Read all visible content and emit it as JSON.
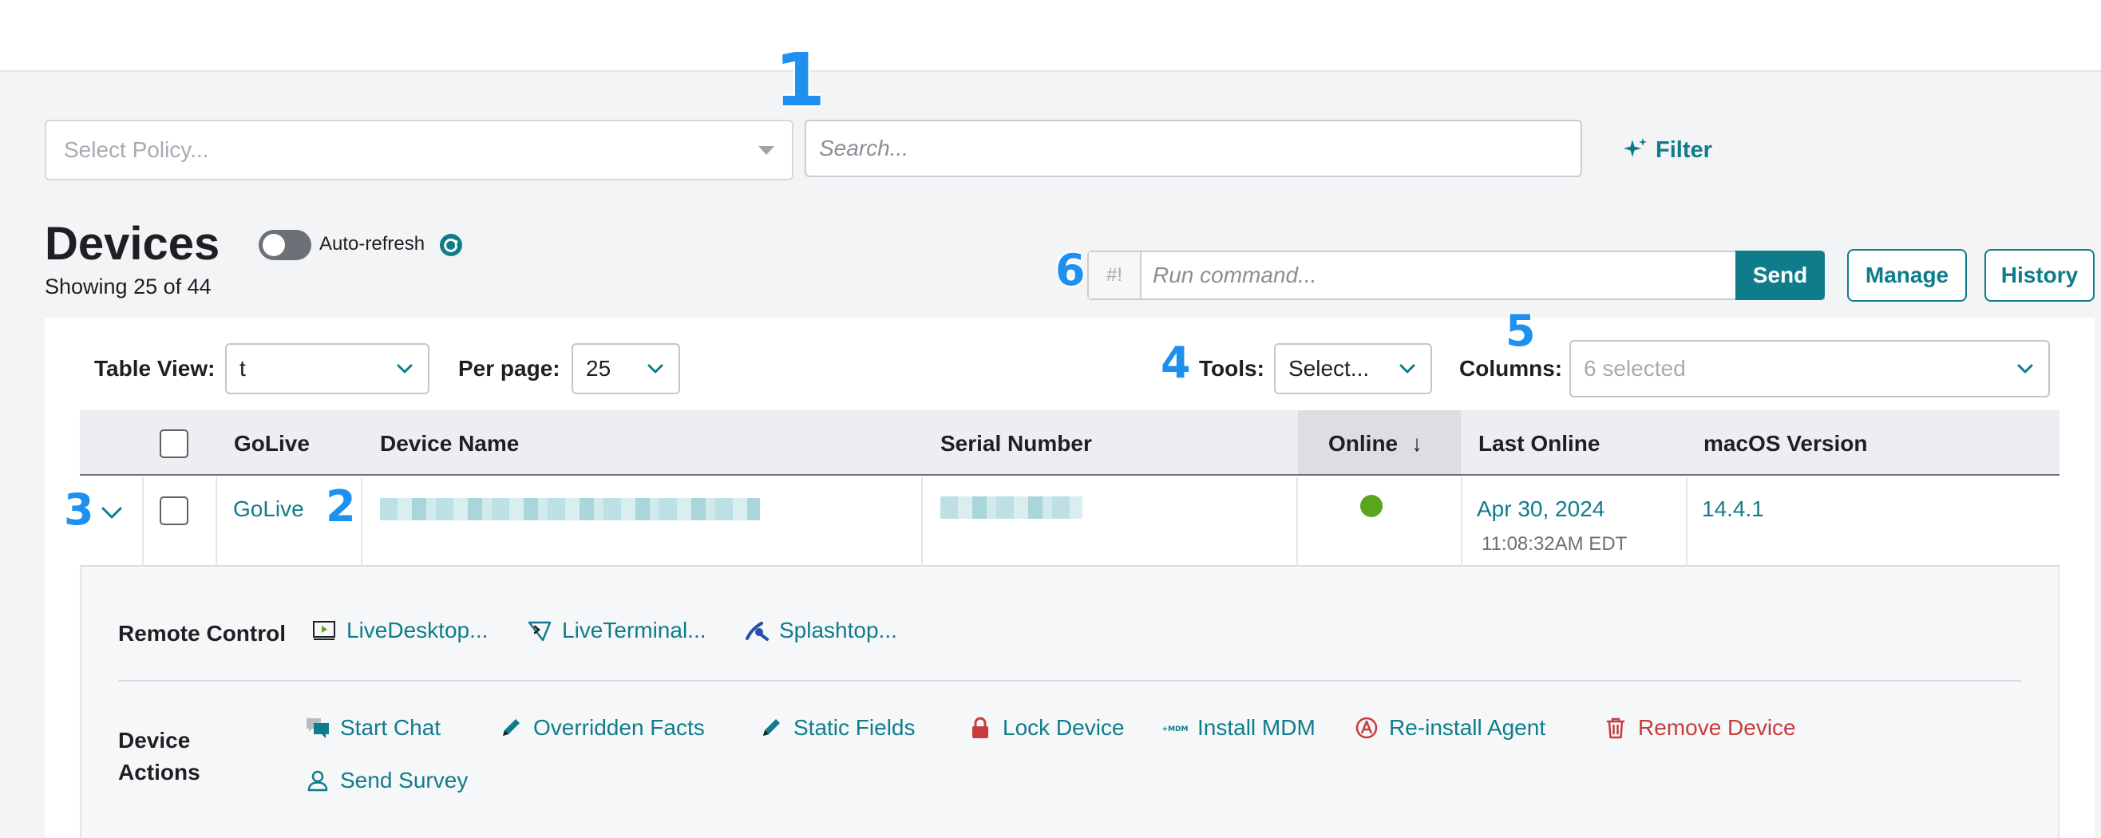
{
  "callouts": [
    "1",
    "2",
    "3",
    "4",
    "5",
    "6"
  ],
  "filters": {
    "policy_placeholder": "Select Policy...",
    "search_placeholder": "Search...",
    "filter_label": "Filter"
  },
  "header": {
    "title": "Devices",
    "showing": "Showing 25 of 44",
    "auto_refresh_label": "Auto-refresh",
    "auto_refresh_on": false
  },
  "command": {
    "prefix": "#!",
    "placeholder": "Run command...",
    "send_label": "Send",
    "manage_label": "Manage",
    "history_label": "History"
  },
  "table_controls": {
    "table_view_label": "Table View:",
    "table_view_value": "t",
    "per_page_label": "Per page:",
    "per_page_value": "25",
    "tools_label": "Tools:",
    "tools_value": "Select...",
    "columns_label": "Columns:",
    "columns_value": "6 selected"
  },
  "columns": [
    "GoLive",
    "Device Name",
    "Serial Number",
    "Online",
    "Last Online",
    "macOS Version"
  ],
  "sort_indicator": "↓",
  "row": {
    "golive": "GoLive",
    "online": true,
    "last_online_date": "Apr 30, 2024",
    "last_online_time": "11:08:32AM EDT",
    "macos_version": "14.4.1"
  },
  "remote_control": {
    "label": "Remote Control",
    "items": [
      "LiveDesktop...",
      "LiveTerminal...",
      "Splashtop..."
    ]
  },
  "device_actions": {
    "label_line1": "Device",
    "label_line2": "Actions",
    "items": [
      "Start Chat",
      "Overridden Facts",
      "Static Fields",
      "Lock Device",
      "Install MDM",
      "Re-install Agent",
      "Remove Device",
      "Send Survey"
    ]
  },
  "colors": {
    "accent": "#0f7c8c",
    "danger": "#c73c3c",
    "online": "#5aa520",
    "callout": "#1e90f0"
  }
}
